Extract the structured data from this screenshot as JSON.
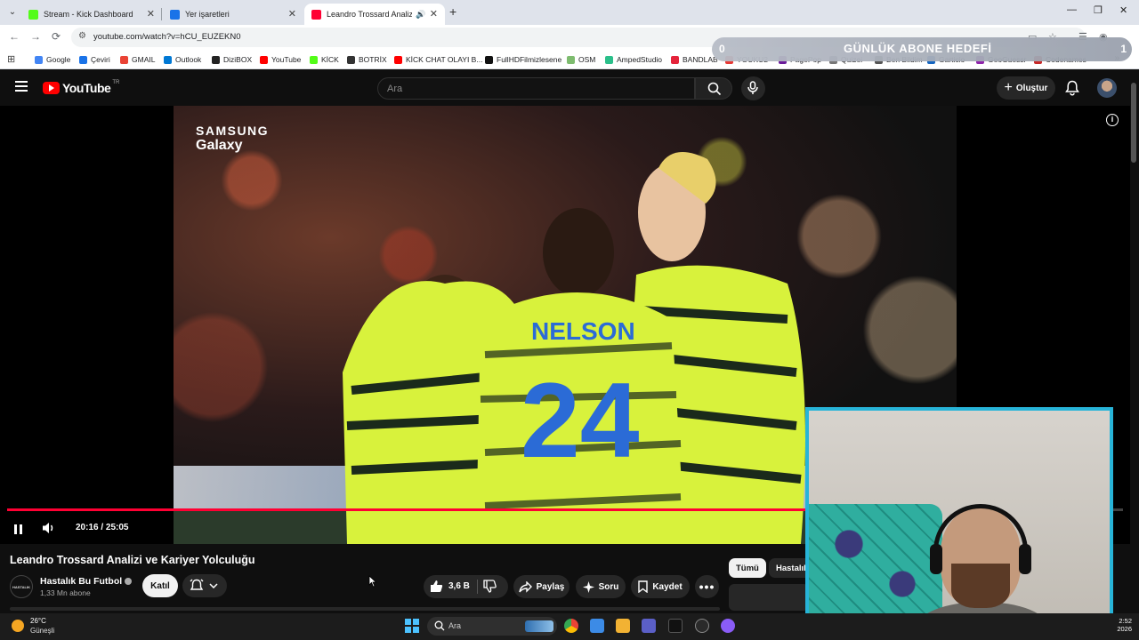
{
  "browser": {
    "tabs": [
      {
        "title": "Stream - Kick Dashboard",
        "favicon_color": "#53fc18",
        "active": false
      },
      {
        "title": "Yer işaretleri",
        "favicon_color": "#1a73e8",
        "active": false
      },
      {
        "title": "Leandro Trossard Analizi ve",
        "favicon_color": "#ff0033",
        "active": true
      }
    ],
    "url": "youtube.com/watch?v=hCU_EUZEKN0",
    "bookmarks": [
      {
        "label": "Google",
        "color": "#4285f4"
      },
      {
        "label": "Çeviri",
        "color": "#1a73e8"
      },
      {
        "label": "GMAIL",
        "color": "#ea4335"
      },
      {
        "label": "Outlook",
        "color": "#0078d4"
      },
      {
        "label": "DiziBOX",
        "color": "#222222"
      },
      {
        "label": "YouTube",
        "color": "#ff0000"
      },
      {
        "label": "KİCK",
        "color": "#53fc18"
      },
      {
        "label": "BOTRİX",
        "color": "#333333"
      },
      {
        "label": "KİCK CHAT OLAYI B...",
        "color": "#ff0000"
      },
      {
        "label": "FullHDFilmizlesene",
        "color": "#111111"
      },
      {
        "label": "OSM",
        "color": "#7ebc6f"
      },
      {
        "label": "AmpedStudio",
        "color": "#2bbf8a"
      },
      {
        "label": "BANDLAB",
        "color": "#e5243b"
      },
      {
        "label": "YOUKU2",
        "color": "#e53935"
      },
      {
        "label": "PagePop",
        "color": "#6a1b9a"
      },
      {
        "label": "Quizei",
        "color": "#777777"
      },
      {
        "label": "Ben Bildim",
        "color": "#555555"
      },
      {
        "label": "Garticio",
        "color": "#1565c0"
      },
      {
        "label": "GeoGuessr",
        "color": "#8e24aa"
      },
      {
        "label": "Codenames",
        "color": "#c62828"
      }
    ]
  },
  "goal_overlay": {
    "title": "GÜNLÜK ABONE HEDEFİ",
    "current": "0",
    "target": "1"
  },
  "youtube": {
    "logo_text": "YouTube",
    "region": "TR",
    "search_placeholder": "Ara",
    "create_label": "Oluştur",
    "video": {
      "title": "Leandro Trossard Analizi ve Kariyer Yolculuğu",
      "sponsor_line1": "SAMSUNG",
      "sponsor_line2": "Galaxy",
      "current_time": "20:16",
      "duration": "25:05",
      "progress_fraction": 0.808
    },
    "channel": {
      "avatar_text": "HASTALIK",
      "name": "Hastalık Bu Futbol",
      "subscribers": "1,33 Mn abone",
      "join_label": "Katıl"
    },
    "actions": {
      "likes": "3,6 B",
      "share": "Paylaş",
      "ask": "Soru",
      "save": "Kaydet"
    },
    "chips": [
      "Tümü",
      "Hastalık"
    ]
  },
  "taskbar": {
    "temperature": "26°C",
    "weather": "Güneşli",
    "search_placeholder": "Ara",
    "time": "2:52",
    "year": "2026"
  }
}
